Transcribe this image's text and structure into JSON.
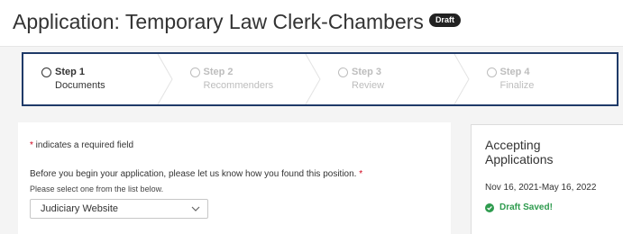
{
  "header": {
    "title": "Application: Temporary Law Clerk-Chambers",
    "badge": "Draft"
  },
  "steps": [
    {
      "title": "Step 1",
      "subtitle": "Documents",
      "state": "active"
    },
    {
      "title": "Step 2",
      "subtitle": "Recommenders",
      "state": "inactive"
    },
    {
      "title": "Step 3",
      "subtitle": "Review",
      "state": "inactive"
    },
    {
      "title": "Step 4",
      "subtitle": "Finalize",
      "state": "inactive"
    }
  ],
  "form": {
    "required_star": "*",
    "required_note": " indicates a required field",
    "question": "Before you begin your application, please let us know how you found this position.",
    "question_star": " *",
    "hint": "Please select one from the list below.",
    "selected_source": "Judiciary Website"
  },
  "sidebar": {
    "status": "Accepting Applications",
    "dates": "Nov 16, 2021-May 16, 2022",
    "saved": "Draft Saved!"
  },
  "colors": {
    "accent": "#1f3a68",
    "required": "#d0021b",
    "success": "#2e9b4e"
  },
  "icons": {
    "step": "radio-ring-icon",
    "select": "chevron-down-icon",
    "saved": "check-circle-icon"
  }
}
